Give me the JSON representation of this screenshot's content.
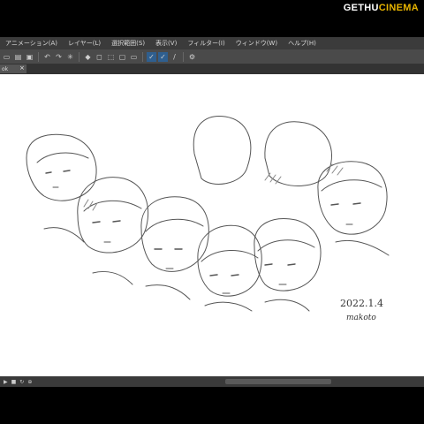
{
  "watermark": {
    "brand_a": "GETHU",
    "brand_b": "CINEMA"
  },
  "menu": [
    "アニメーション(A)",
    "レイヤー(L)",
    "選択範囲(S)",
    "表示(V)",
    "フィルター(I)",
    "ウィンドウ(W)",
    "ヘルプ(H)"
  ],
  "tab": {
    "label": "ok",
    "close": "×"
  },
  "toolbar_icons": [
    "new-icon",
    "open-icon",
    "save-icon",
    "undo-icon",
    "redo-icon",
    "loading-icon",
    "fill-icon",
    "clear-icon",
    "transform-icon",
    "fit-icon",
    "ruler-icon",
    "pen-icon",
    "pencil-icon",
    "brush-icon",
    "eraser-icon",
    "settings-icon"
  ],
  "drawing": {
    "signature_date": "2022.1.4",
    "signature_name": "makoto"
  },
  "colors": {
    "menubar": "#3b3b3b",
    "toolbar": "#4a4a4a",
    "canvas": "#ffffff",
    "accent": "#e8b400",
    "selected": "#2f5f8f"
  }
}
